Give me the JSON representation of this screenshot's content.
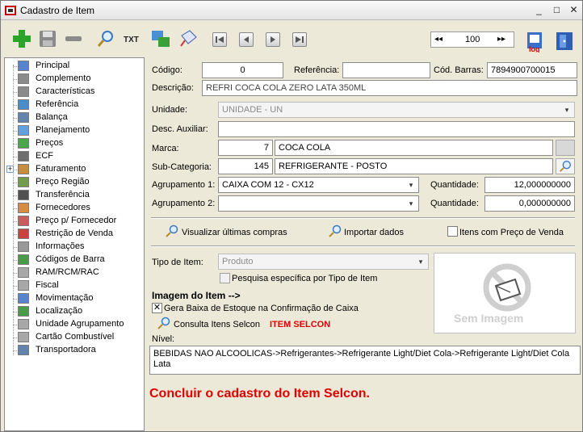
{
  "window": {
    "title": "Cadastro de Item",
    "minimize": "_",
    "maximize": "□",
    "close": "✕"
  },
  "toolbar": {
    "icons": [
      "add-icon",
      "save-icon",
      "remove-icon",
      "search-icon",
      "txt-icon",
      "sync-icon",
      "copy-icon",
      "first-icon",
      "prev-icon",
      "next-icon",
      "last-icon",
      "log-icon",
      "exit-icon"
    ],
    "pager": {
      "prev": "◂◂",
      "value": "100",
      "next": "▸▸"
    }
  },
  "sidebar": {
    "items": [
      {
        "label": "Principal",
        "icon": "list-icon"
      },
      {
        "label": "Complemento",
        "icon": "paperclip-icon"
      },
      {
        "label": "Características",
        "icon": "paperclip-icon"
      },
      {
        "label": "Referência",
        "icon": "reference-icon"
      },
      {
        "label": "Balança",
        "icon": "scale-icon"
      },
      {
        "label": "Planejamento",
        "icon": "calendar-icon"
      },
      {
        "label": "Preços",
        "icon": "price-icon"
      },
      {
        "label": "ECF",
        "icon": "printer-icon"
      },
      {
        "label": "Faturamento",
        "icon": "billing-icon",
        "expandable": true
      },
      {
        "label": "Preço Região",
        "icon": "region-icon"
      },
      {
        "label": "Transferência",
        "icon": "transfer-icon"
      },
      {
        "label": "Fornecedores",
        "icon": "suppliers-icon"
      },
      {
        "label": "Preço p/ Fornecedor",
        "icon": "supplier-price-icon"
      },
      {
        "label": "Restrição de Venda",
        "icon": "restriction-icon"
      },
      {
        "label": "Informações",
        "icon": "info-icon"
      },
      {
        "label": "Códigos de Barra",
        "icon": "barcode-icon"
      },
      {
        "label": "RAM/RCM/RAC",
        "icon": "document-icon"
      },
      {
        "label": "Fiscal",
        "icon": "document-icon"
      },
      {
        "label": "Movimentação",
        "icon": "movement-icon"
      },
      {
        "label": "Localização",
        "icon": "location-icon"
      },
      {
        "label": "Unidade Agrupamento",
        "icon": "document-icon"
      },
      {
        "label": "Cartão Combustível",
        "icon": "document-icon"
      },
      {
        "label": "Transportadora",
        "icon": "truck-icon"
      }
    ]
  },
  "form": {
    "codigo_label": "Código:",
    "codigo": "0",
    "referencia_label": "Referência:",
    "referencia": "",
    "barras_label": "Cód. Barras:",
    "barras": "7894900700015",
    "descricao_label": "Descrição:",
    "descricao": "REFRI COCA COLA ZERO LATA 350ML",
    "unidade_label": "Unidade:",
    "unidade": "UNIDADE - UN",
    "desc_aux_label": "Desc. Auxiliar:",
    "desc_aux": "",
    "marca_label": "Marca:",
    "marca_code": "7",
    "marca_name": "COCA COLA",
    "subcat_label": "Sub-Categoria:",
    "subcat_code": "145",
    "subcat_name": "REFRIGERANTE - POSTO",
    "agrup1_label": "Agrupamento 1:",
    "agrup1": "CAIXA COM 12 - CX12",
    "qtd1_label": "Quantidade:",
    "qtd1": "12,000000000",
    "agrup2_label": "Agrupamento 2:",
    "agrup2": "",
    "qtd2_label": "Quantidade:",
    "qtd2": "0,000000000",
    "ver_compras": "Visualizar últimas compras",
    "importar": "Importar dados",
    "itens_preco": "Itens com Preço de Venda",
    "tipo_label": "Tipo de Item:",
    "tipo": "Produto",
    "pesquisa_tipo": "Pesquisa específica por Tipo de Item",
    "imagem_label": "Imagem do Item -->",
    "gera_baixa": "Gera Baixa de Estoque na Confirmação de Caixa",
    "consulta_selcon": "Consulta Itens Selcon",
    "item_selcon": "ITEM SELCON",
    "sem_imagem": "Sem Imagem",
    "nivel_label": "Nível:",
    "nivel": "BEBIDAS NAO ALCOOLICAS->Refrigerantes->Refrigerante Light/Diet Cola->Refrigerante Light/Diet Cola Lata",
    "concluir": "Concluir o cadastro do Item Selcon."
  },
  "colors": {
    "accent_red": "#e00000",
    "window_bg": "#ece9d8"
  }
}
